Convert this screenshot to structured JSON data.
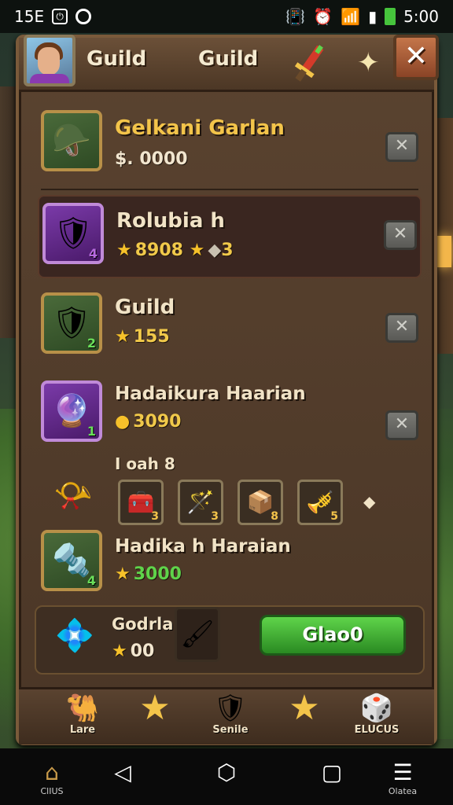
{
  "status_bar": {
    "left_text": "15E",
    "time": "5:00",
    "icons": [
      "app-icon",
      "sync-icon",
      "vibrate-icon",
      "alarm-icon",
      "wifi-icon",
      "signal-icon",
      "battery-icon"
    ]
  },
  "header": {
    "title_1": "Guild",
    "title_2": "Guild",
    "close_label": "✕"
  },
  "rows": [
    {
      "name": "Gelkani Garlan",
      "value": "$. 0000",
      "level": ""
    },
    {
      "name": "Rolubia h",
      "value": "8908",
      "value_2": "3"
    },
    {
      "name": "Guild",
      "value": "155",
      "level": "2"
    },
    {
      "name": "Hadaikura Haarian",
      "value": "3090",
      "level": "1"
    }
  ],
  "subsection": {
    "label": "I oah 8",
    "slots": [
      {
        "icon": "treasure-chest-icon",
        "level": "3"
      },
      {
        "icon": "staff-icon",
        "level": "3"
      },
      {
        "icon": "chest-icon",
        "level": "8"
      },
      {
        "icon": "horn-icon",
        "level": "5"
      }
    ]
  },
  "row_5": {
    "name": "Hadika h Haraian",
    "value": "3000",
    "level": "4"
  },
  "bottom": {
    "name": "Godrlans",
    "value": "00",
    "go_label": "Glao0"
  },
  "nav": [
    {
      "label": "Lare",
      "icon": "camel-icon"
    },
    {
      "label": "",
      "icon": "star-icon"
    },
    {
      "label": "Senile",
      "icon": "shield-icon"
    },
    {
      "label": "",
      "icon": "star-icon"
    },
    {
      "label": "ELUCUS",
      "icon": "dice-icon"
    }
  ],
  "system_nav": [
    {
      "label": "ClIUS",
      "icon": "home-icon"
    },
    {
      "label": "",
      "icon": "back-icon"
    },
    {
      "label": "",
      "icon": "home-circle-icon"
    },
    {
      "label": "",
      "icon": "recents-icon"
    },
    {
      "label": "Olatea",
      "icon": "menu-icon"
    }
  ],
  "colors": {
    "accent_gold": "#f3c44a",
    "go_green": "#3aa52e",
    "panel_brown": "#4a3626",
    "close_orange": "#b8653a"
  }
}
